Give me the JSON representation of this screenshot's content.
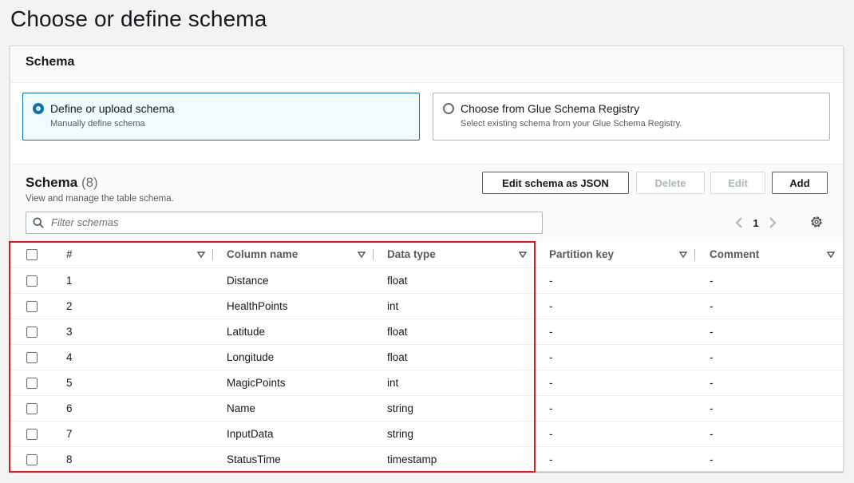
{
  "page": {
    "title": "Choose or define schema"
  },
  "section": {
    "title": "Schema"
  },
  "options": [
    {
      "label": "Define or upload schema",
      "description": "Manually define schema",
      "selected": true
    },
    {
      "label": "Choose from Glue Schema Registry",
      "description": "Select existing schema from your Glue Schema Registry.",
      "selected": false
    }
  ],
  "schema_table": {
    "title": "Schema",
    "count": "(8)",
    "description": "View and manage the table schema.",
    "buttons": {
      "edit_json": "Edit schema as JSON",
      "delete": "Delete",
      "edit": "Edit",
      "add": "Add"
    },
    "filter_placeholder": "Filter schemas",
    "page": "1",
    "columns": [
      "#",
      "Column name",
      "Data type",
      "Partition key",
      "Comment"
    ],
    "rows": [
      {
        "num": "1",
        "name": "Distance",
        "type": "float",
        "partition": "-",
        "comment": "-"
      },
      {
        "num": "2",
        "name": "HealthPoints",
        "type": "int",
        "partition": "-",
        "comment": "-"
      },
      {
        "num": "3",
        "name": "Latitude",
        "type": "float",
        "partition": "-",
        "comment": "-"
      },
      {
        "num": "4",
        "name": "Longitude",
        "type": "float",
        "partition": "-",
        "comment": "-"
      },
      {
        "num": "5",
        "name": "MagicPoints",
        "type": "int",
        "partition": "-",
        "comment": "-"
      },
      {
        "num": "6",
        "name": "Name",
        "type": "string",
        "partition": "-",
        "comment": "-"
      },
      {
        "num": "7",
        "name": "InputData",
        "type": "string",
        "partition": "-",
        "comment": "-"
      },
      {
        "num": "8",
        "name": "StatusTime",
        "type": "timestamp",
        "partition": "-",
        "comment": "-"
      }
    ]
  },
  "colors": {
    "accent": "#0073bb",
    "highlight": "#e4161c"
  }
}
